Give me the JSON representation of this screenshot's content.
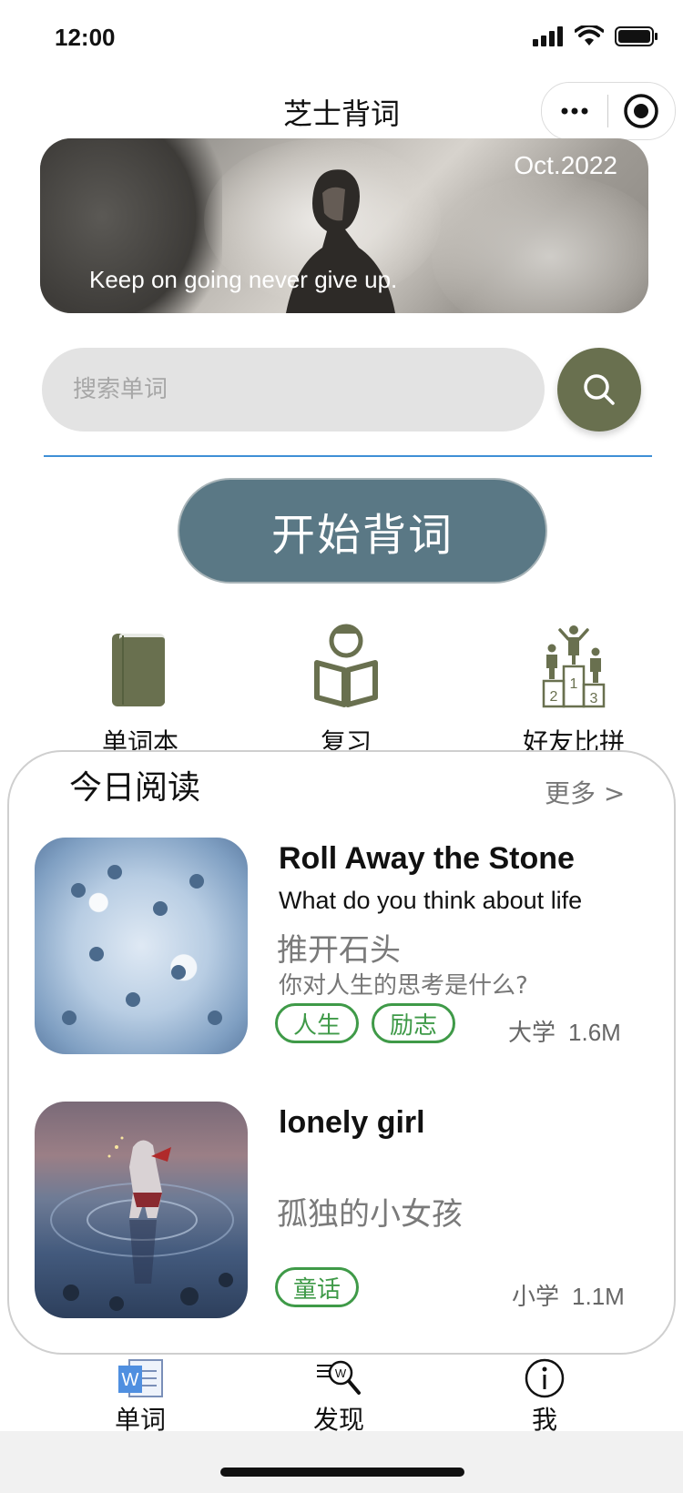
{
  "status": {
    "time": "12:00"
  },
  "nav": {
    "title": "芝士背词"
  },
  "banner": {
    "date": "Oct.2022",
    "quote": "Keep on going never give up."
  },
  "search": {
    "placeholder": "搜索单词",
    "value": ""
  },
  "start": {
    "label": "开始背词"
  },
  "features": [
    {
      "label": "单词本",
      "icon": "book-icon"
    },
    {
      "label": "复习",
      "icon": "reading-person-icon"
    },
    {
      "label": "好友比拼",
      "icon": "podium-icon"
    }
  ],
  "reading": {
    "title": "今日阅读",
    "more": "更多 >",
    "articles": [
      {
        "en_title": "Roll Away the Stone",
        "en_subtitle": "What do you think about life",
        "cn_title": "推开石头",
        "cn_subtitle": "你对人生的思考是什么?",
        "tags": [
          "人生",
          "励志"
        ],
        "level": "大学",
        "size": "1.6M"
      },
      {
        "en_title": "lonely girl",
        "en_subtitle": "",
        "cn_title": "孤独的小女孩",
        "cn_subtitle": "",
        "tags": [
          "童话"
        ],
        "level": "小学",
        "size": "1.1M"
      }
    ]
  },
  "tabs": [
    {
      "label": "单词",
      "icon": "word-doc-icon"
    },
    {
      "label": "发现",
      "icon": "search-word-icon"
    },
    {
      "label": "我",
      "icon": "info-icon"
    }
  ],
  "colors": {
    "accent_olive": "#69704f",
    "start_button": "#5a7885",
    "tag_green": "#3f9a48",
    "divider_blue": "#3f8fd6"
  }
}
